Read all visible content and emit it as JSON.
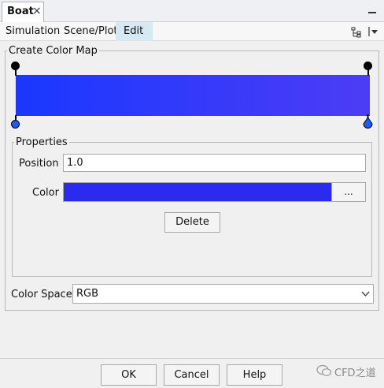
{
  "window": {
    "tab_title": "Boat",
    "close_glyph": "×"
  },
  "menu": {
    "items": [
      "Simulation",
      "Scene/Plot",
      "Edit"
    ],
    "active": "Edit"
  },
  "editor": {
    "group_title": "Create Color Map",
    "gradient": {
      "start_color": "#1a38ff",
      "end_color": "#4d3cf5"
    },
    "properties": {
      "group_title": "Properties",
      "position_label": "Position",
      "position_value": "1.0",
      "color_label": "Color",
      "color_value": "#2a2af0",
      "browse_label": "...",
      "delete_label": "Delete"
    },
    "color_space": {
      "label": "Color Space",
      "value": "RGB"
    }
  },
  "footer": {
    "ok_label": "OK",
    "cancel_label": "Cancel",
    "help_label": "Help",
    "watermark": "CFD之道"
  },
  "colors": {
    "menu_active_bg": "#d6e9f2",
    "stop_dot_fill": "#1a5cff"
  }
}
